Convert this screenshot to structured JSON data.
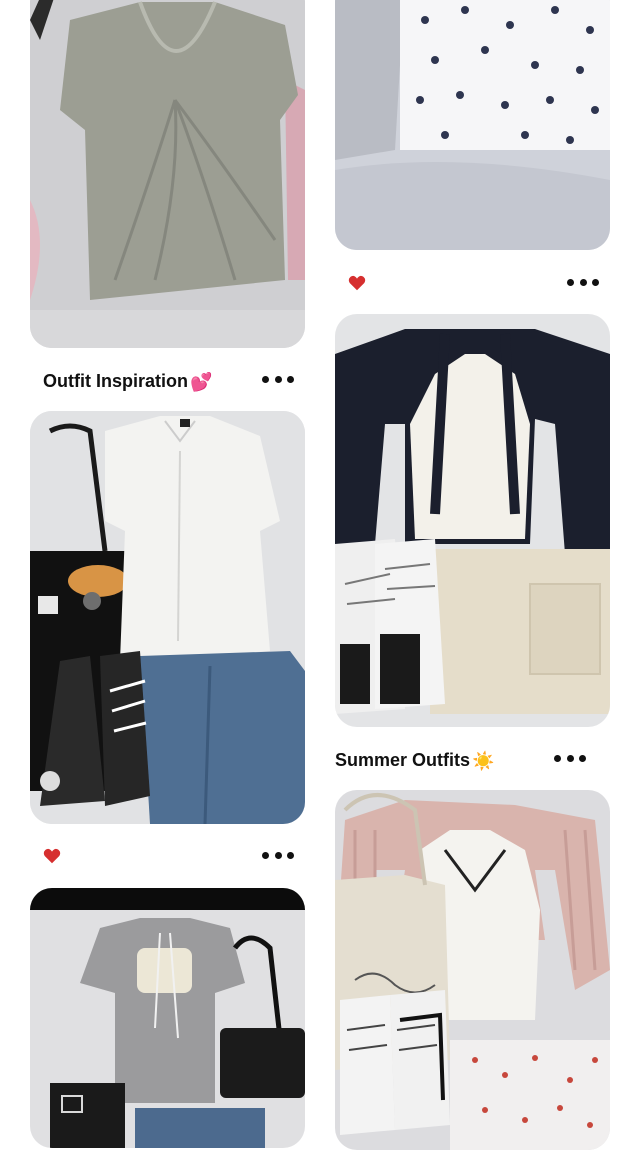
{
  "feed": {
    "left": {
      "caption_1": "Outfit Inspiration",
      "caption_1_emoji": "💕"
    },
    "right": {
      "caption_1": "Summer Outfits",
      "caption_1_emoji": "☀️"
    }
  },
  "icons": {
    "heart": "heart-icon",
    "more": "more-options-icon"
  },
  "colors": {
    "heart": "#d62f2f",
    "bed_sheet": "#d9dadc",
    "accent_dark": "#1a1d2e"
  }
}
